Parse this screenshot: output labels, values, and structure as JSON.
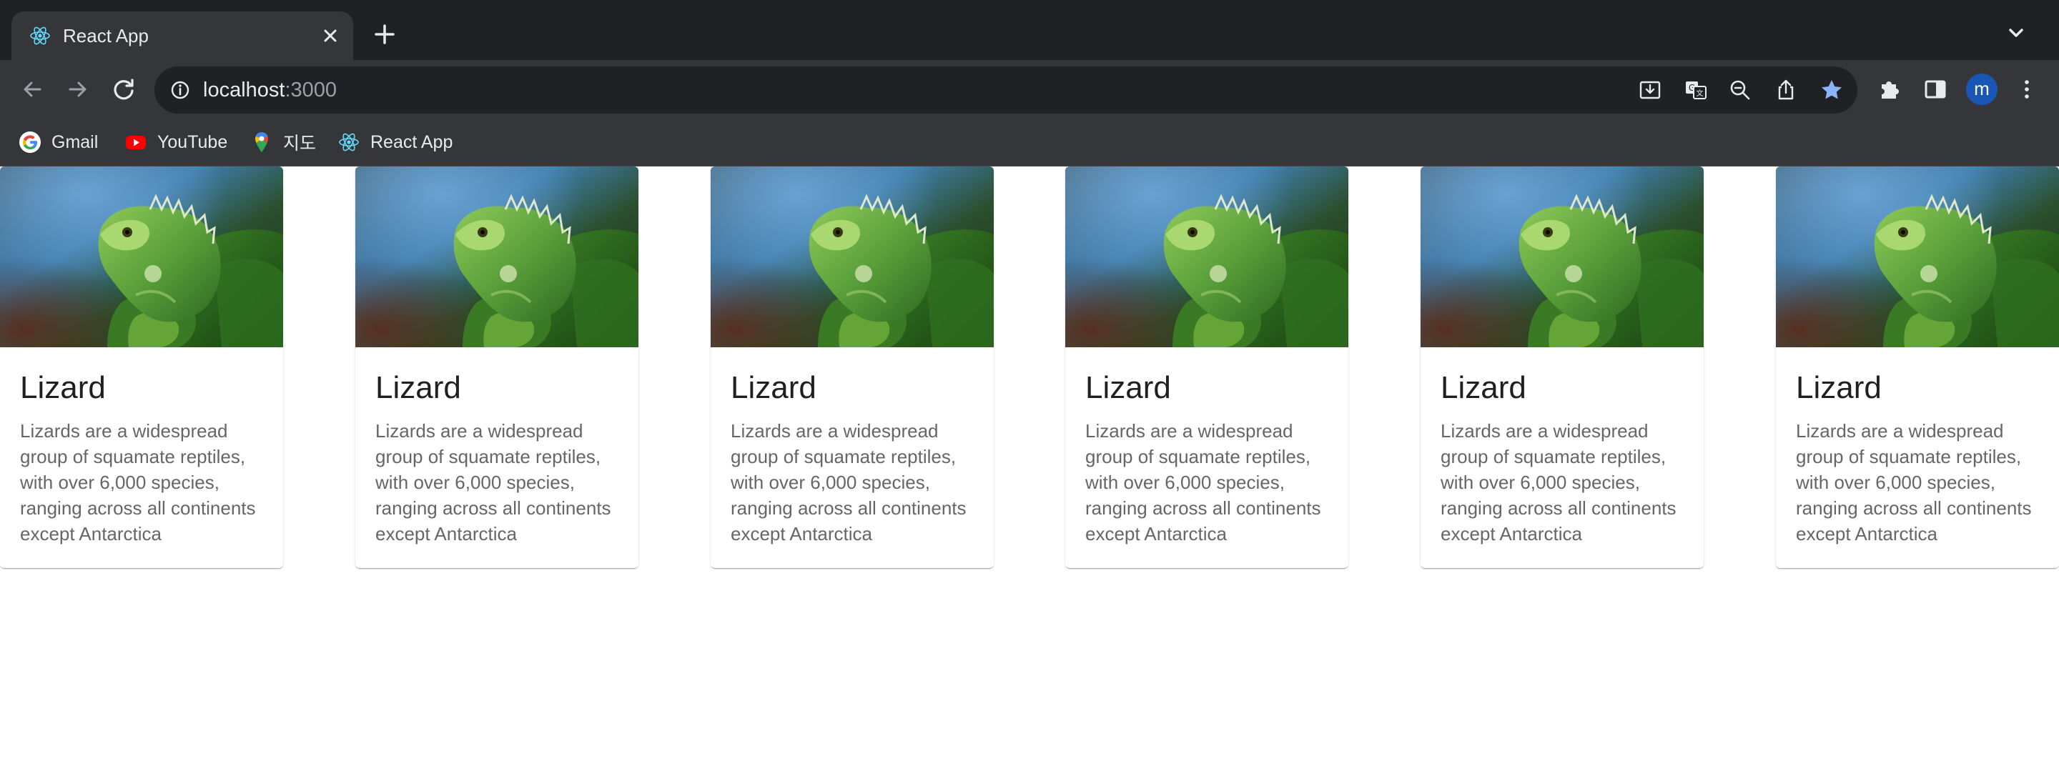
{
  "browser": {
    "tab": {
      "title": "React App"
    },
    "address": {
      "host": "localhost",
      "port": ":3000"
    },
    "bookmarks": [
      {
        "label": "Gmail",
        "icon": "google-icon"
      },
      {
        "label": "YouTube",
        "icon": "youtube-icon"
      },
      {
        "label": "지도",
        "icon": "maps-pin-icon"
      },
      {
        "label": "React App",
        "icon": "react-icon"
      }
    ],
    "profile_initial": "m",
    "colors": {
      "frame": "#202124",
      "toolbar": "#35363a",
      "star": "#8ab4f8",
      "avatar": "#1a56b5"
    }
  },
  "cards": [
    {
      "title": "Lizard",
      "body": "Lizards are a widespread group of squamate reptiles, with over 6,000 species, ranging across all continents except Antarctica"
    },
    {
      "title": "Lizard",
      "body": "Lizards are a widespread group of squamate reptiles, with over 6,000 species, ranging across all continents except Antarctica"
    },
    {
      "title": "Lizard",
      "body": "Lizards are a widespread group of squamate reptiles, with over 6,000 species, ranging across all continents except Antarctica"
    },
    {
      "title": "Lizard",
      "body": "Lizards are a widespread group of squamate reptiles, with over 6,000 species, ranging across all continents except Antarctica"
    },
    {
      "title": "Lizard",
      "body": "Lizards are a widespread group of squamate reptiles, with over 6,000 species, ranging across all continents except Antarctica"
    },
    {
      "title": "Lizard",
      "body": "Lizards are a widespread group of squamate reptiles, with over 6,000 species, ranging across all continents except Antarctica"
    }
  ]
}
